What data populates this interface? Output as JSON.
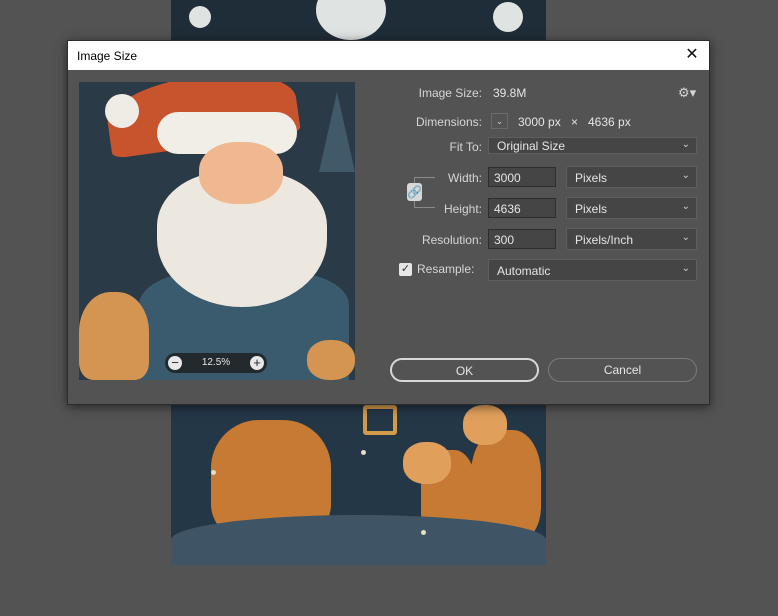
{
  "dialog": {
    "title": "Image Size",
    "close_glyph": "✕",
    "gear_glyph": "⚙▾",
    "image_size_label": "Image Size:",
    "image_size_value": "39.8M",
    "dimensions_label": "Dimensions:",
    "dimensions_width": "3000 px",
    "dimensions_times": "×",
    "dimensions_height": "4636 px",
    "dimensions_dropdown_glyph": "⌄",
    "fit_to_label": "Fit To:",
    "fit_to_value": "Original Size",
    "width_label": "Width:",
    "width_value": "3000",
    "width_unit": "Pixels",
    "height_label": "Height:",
    "height_value": "4636",
    "height_unit": "Pixels",
    "resolution_label": "Resolution:",
    "resolution_value": "300",
    "resolution_unit": "Pixels/Inch",
    "resample_label": "Resample:",
    "resample_checked": true,
    "resample_value": "Automatic",
    "ok_label": "OK",
    "cancel_label": "Cancel",
    "chevron_glyph": "⌄",
    "chain_glyph": "🔗"
  },
  "preview": {
    "zoom_level": "12.5%",
    "zoom_out_glyph": "−",
    "zoom_in_glyph": "+"
  }
}
